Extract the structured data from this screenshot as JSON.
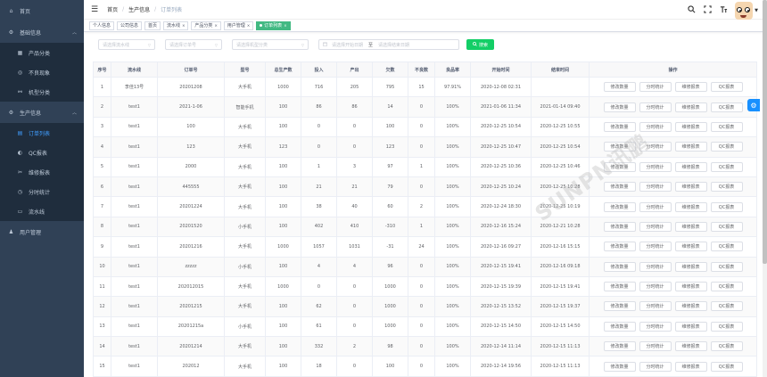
{
  "colors": {
    "sidebar_bg": "#304156",
    "active": "#409eff",
    "tag_active": "#42b983",
    "search_btn": "#13ce66",
    "fab": "#1890ff"
  },
  "sidebar": {
    "items": [
      {
        "label": "首页",
        "icon": "home-icon",
        "level": 0
      },
      {
        "label": "基础信息",
        "icon": "gear-icon",
        "level": 0,
        "chevron": "chevron-up-icon"
      },
      {
        "label": "产品分类",
        "icon": "grid-icon",
        "level": 1
      },
      {
        "label": "不良现象",
        "icon": "circle-icon",
        "level": 1
      },
      {
        "label": "机型分类",
        "icon": "bicycle-icon",
        "level": 1
      },
      {
        "label": "生产信息",
        "icon": "gear-icon",
        "level": 0,
        "chevron": "chevron-up-icon"
      },
      {
        "label": "订单列表",
        "icon": "list-icon",
        "level": 1,
        "active": true
      },
      {
        "label": "QC报表",
        "icon": "qc-icon",
        "level": 1
      },
      {
        "label": "维修报表",
        "icon": "tools-icon",
        "level": 1
      },
      {
        "label": "分时统计",
        "icon": "clock-icon",
        "level": 1
      },
      {
        "label": "流水线",
        "icon": "line-icon",
        "level": 1
      },
      {
        "label": "用户管理",
        "icon": "user-icon",
        "level": 0
      }
    ]
  },
  "breadcrumb": {
    "home": "首页",
    "sep": "/",
    "mid": "生产信息",
    "current": "订单列表"
  },
  "tags": [
    {
      "label": "个人信息"
    },
    {
      "label": "公司信息"
    },
    {
      "label": "首页"
    },
    {
      "label": "流水线",
      "closable": true
    },
    {
      "label": "产品分类",
      "closable": true
    },
    {
      "label": "用户管理",
      "closable": true
    },
    {
      "label": "订单列表",
      "closable": true,
      "active": true
    }
  ],
  "filters": {
    "line_placeholder": "请选择流水线",
    "order_placeholder": "请选择订单号",
    "model_placeholder": "请选择机型分类",
    "start_placeholder": "请选择开始日期",
    "end_placeholder": "请选择结束日期",
    "date_sep": "至",
    "search_label": "搜索"
  },
  "table": {
    "headers": [
      "序号",
      "流水线",
      "订单号",
      "型号",
      "总生产数",
      "投入",
      "产出",
      "欠数",
      "不良数",
      "良品率",
      "开始时间",
      "结束时间",
      "操作"
    ],
    "actions": [
      "修改数量",
      "分时统计",
      "维修报表",
      "QC报表"
    ],
    "rows": [
      [
        "1",
        "李佳13号",
        "20201208",
        "大手机",
        "1000",
        "716",
        "205",
        "795",
        "15",
        "97.91%",
        "2020-12-08 02:31",
        ""
      ],
      [
        "2",
        "test1",
        "2021-1-06",
        "智能手机",
        "100",
        "86",
        "86",
        "14",
        "0",
        "100%",
        "2021-01-06 11:34",
        "2021-01-14 09:40"
      ],
      [
        "3",
        "test1",
        "100",
        "大手机",
        "100",
        "0",
        "0",
        "100",
        "0",
        "100%",
        "2020-12-25 10:54",
        "2020-12-25 10:55"
      ],
      [
        "4",
        "test1",
        "123",
        "大手机",
        "123",
        "0",
        "0",
        "123",
        "0",
        "100%",
        "2020-12-25 10:47",
        "2020-12-25 10:54"
      ],
      [
        "5",
        "test1",
        "2000",
        "大手机",
        "100",
        "1",
        "3",
        "97",
        "1",
        "100%",
        "2020-12-25 10:36",
        "2020-12-25 10:46"
      ],
      [
        "6",
        "test1",
        "445555",
        "大手机",
        "100",
        "21",
        "21",
        "79",
        "0",
        "100%",
        "2020-12-25 10:24",
        "2020-12-25 10:28"
      ],
      [
        "7",
        "test1",
        "20201224",
        "大手机",
        "100",
        "38",
        "40",
        "60",
        "2",
        "100%",
        "2020-12-24 18:30",
        "2020-12-25 10:19"
      ],
      [
        "8",
        "test1",
        "20201520",
        "小手机",
        "100",
        "402",
        "410",
        "-310",
        "1",
        "100%",
        "2020-12-16 15:24",
        "2020-12-21 10:28"
      ],
      [
        "9",
        "test1",
        "20201216",
        "大手机",
        "1000",
        "1057",
        "1031",
        "-31",
        "24",
        "100%",
        "2020-12-16 09:27",
        "2020-12-16 15:15"
      ],
      [
        "10",
        "test1",
        "zzzzz",
        "小手机",
        "100",
        "4",
        "4",
        "96",
        "0",
        "100%",
        "2020-12-15 19:41",
        "2020-12-16 09:18"
      ],
      [
        "11",
        "test1",
        "202012015",
        "大手机",
        "1000",
        "0",
        "0",
        "1000",
        "0",
        "100%",
        "2020-12-15 19:39",
        "2020-12-15 19:41"
      ],
      [
        "12",
        "test1",
        "20201215",
        "大手机",
        "100",
        "62",
        "0",
        "1000",
        "0",
        "100%",
        "2020-12-15 13:52",
        "2020-12-15 19:37"
      ],
      [
        "13",
        "test1",
        "20201215a",
        "小手机",
        "100",
        "61",
        "0",
        "1000",
        "0",
        "100%",
        "2020-12-15 14:50",
        "2020-12-15 14:50"
      ],
      [
        "14",
        "test1",
        "20201214",
        "大手机",
        "100",
        "332",
        "2",
        "98",
        "0",
        "100%",
        "2020-12-14 11:14",
        "2020-12-15 11:13"
      ],
      [
        "15",
        "test1",
        "202012",
        "大手机",
        "100",
        "18",
        "0",
        "100",
        "0",
        "100%",
        "2020-12-14 19:56",
        "2020-12-15 11:13"
      ]
    ]
  },
  "watermark": "SUNPN讯鹏"
}
